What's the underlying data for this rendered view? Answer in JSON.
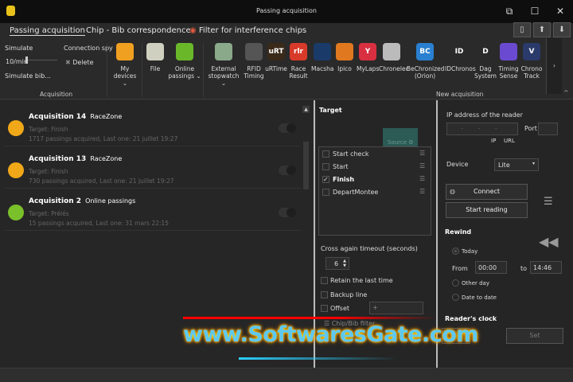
{
  "window": {
    "title": "Passing acquisition",
    "restore": "⧉",
    "maximize": "☐",
    "close": "✕"
  },
  "tabs": [
    {
      "label": "Passing acquisition"
    },
    {
      "label": "Chip - Bib correspondence"
    },
    {
      "label": "Filter for interference chips"
    }
  ],
  "tab_buttons": [
    "▯",
    "⬆",
    "⬇"
  ],
  "ribbon": {
    "acquisition": {
      "simulate": "Simulate",
      "rate": "10/min",
      "simulate_bib": "Simulate bib...",
      "connection_spy": "Connection spy",
      "delete": "Delete",
      "label": "Acquisition"
    },
    "buttons": [
      {
        "label": "My devices",
        "sub": "⌄",
        "icon": "devices-icon",
        "color": "#f0a020"
      },
      {
        "label": "File",
        "icon": "file-icon",
        "color": "#d0d0c0"
      },
      {
        "label": "Online passings ⌄",
        "icon": "cloud-icon",
        "color": "#6ab82a"
      },
      {
        "label": "External stopwatch ⌄",
        "icon": "stopwatch-icon",
        "color": "#8aa88a"
      },
      {
        "label": "RFID Timing",
        "icon": "rfid-icon",
        "color": "#555"
      },
      {
        "label": "uRTime",
        "icon": "urtime-icon",
        "color": "#3a2a1a",
        "glyph": "uRT"
      },
      {
        "label": "Race Result",
        "icon": "raceresult-icon",
        "color": "#d83a2a",
        "glyph": "rlr"
      },
      {
        "label": "Macsha",
        "icon": "macsha-icon",
        "color": "#1a3a6a"
      },
      {
        "label": "Ipico",
        "icon": "ipico-icon",
        "color": "#e07820"
      },
      {
        "label": "MyLaps",
        "icon": "mylaps-icon",
        "color": "#d83040",
        "glyph": "Y"
      },
      {
        "label": "Chronelec",
        "icon": "chronelec-icon",
        "color": "#bbb"
      },
      {
        "label": "BeChronized (Orion)",
        "icon": "bechronized-icon",
        "color": "#2a80d0",
        "glyph": "BC"
      },
      {
        "label": "IDChronos",
        "icon": "idchronos-icon",
        "color": "#2a2a2a",
        "glyph": "ID"
      },
      {
        "label": "Dag System",
        "icon": "dag-icon",
        "color": "#2a2a2a",
        "glyph": "D"
      },
      {
        "label": "Timing Sense",
        "icon": "timingsense-icon",
        "color": "#6a4ad0"
      },
      {
        "label": "Chrono Track",
        "icon": "chronotrack-icon",
        "color": "#2a3a6a",
        "glyph": "V"
      }
    ],
    "new_acquisition_label": "New acquisition",
    "more": "›",
    "collapse": "^"
  },
  "acquisitions": [
    {
      "name": "Acquisition 14",
      "source": "RaceZone",
      "target": "Target: Finish",
      "info": "1717 passings acquired, Last one: 21 juillet 19:27",
      "icon": "racezone-icon"
    },
    {
      "name": "Acquisition 13",
      "source": "RaceZone",
      "target": "Target: Finish",
      "info": "730 passings acquired, Last one: 21 juillet 19:27",
      "icon": "racezone-icon"
    },
    {
      "name": "Acquisition 2",
      "source": "Online passings",
      "target": "Target: Prélés",
      "info": "15 passings acquired, Last one: 31 mars 22:15",
      "icon": "cloud-icon"
    }
  ],
  "target": {
    "title": "Target",
    "source_label": "Source ⚙",
    "items": [
      {
        "label": "Start check",
        "checked": false
      },
      {
        "label": "Start",
        "checked": false
      },
      {
        "label": "Finish",
        "checked": true
      },
      {
        "label": "DepartMontee",
        "checked": false
      }
    ],
    "cross_timeout_label": "Cross again timeout (seconds)",
    "cross_timeout_value": "6",
    "retain": "Retain the last time",
    "backup": "Backup line",
    "offset": "Offset",
    "offset_sign": "+",
    "chip_filter": "Chip/Bib filter"
  },
  "reader": {
    "ip_label": "IP address of the reader",
    "ip_value": ". . .",
    "port_label": "Port",
    "ip_opt": "IP",
    "url_opt": "URL",
    "device_label": "Device",
    "device_value": "Lite",
    "connect": "Connect",
    "start_reading": "Start reading",
    "rewind": "Rewind",
    "today": "Today",
    "from": "From",
    "from_value": "00:00",
    "to": "to",
    "to_value": "14:46",
    "other_day": "Other day",
    "date_to_date": "Date to date",
    "clock": "Reader's clock",
    "set": "Set"
  },
  "watermark": "www.SoftwaresGate.com"
}
